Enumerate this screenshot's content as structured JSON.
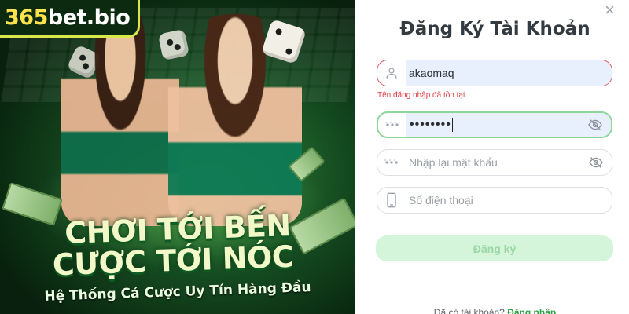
{
  "banner": {
    "logo_number": "365",
    "logo_text": "bet.bio",
    "headline_line1": "CHƠI TỚI BẾN",
    "headline_line2": "CƯỢC TỚI NÓC",
    "tagline": "Hệ Thống Cá Cược Uy Tín Hàng Đầu"
  },
  "form": {
    "title": "Đăng Ký Tài Khoản",
    "close_symbol": "×",
    "username": {
      "value": "akaomaq",
      "icon": "user-icon"
    },
    "username_error": "Tên đăng nhập đã tồn tại.",
    "password": {
      "value": "••••••••",
      "icon": "key-dots-icon",
      "toggle_icon": "eye-off-icon"
    },
    "confirm_password": {
      "placeholder": "Nhập lại mật khẩu",
      "icon": "key-dots-icon",
      "toggle_icon": "eye-off-icon"
    },
    "phone": {
      "placeholder": "Số điện thoại",
      "icon": "phone-icon"
    },
    "submit_label": "Đăng ký",
    "login_prompt": "Đã có tài khoản?",
    "login_link": "Đăng nhập"
  },
  "colors": {
    "error": "#e0383e",
    "accent_green": "#2c9f47",
    "submit_bg": "#d4f5d9",
    "autofill_bg": "#e8effd"
  }
}
